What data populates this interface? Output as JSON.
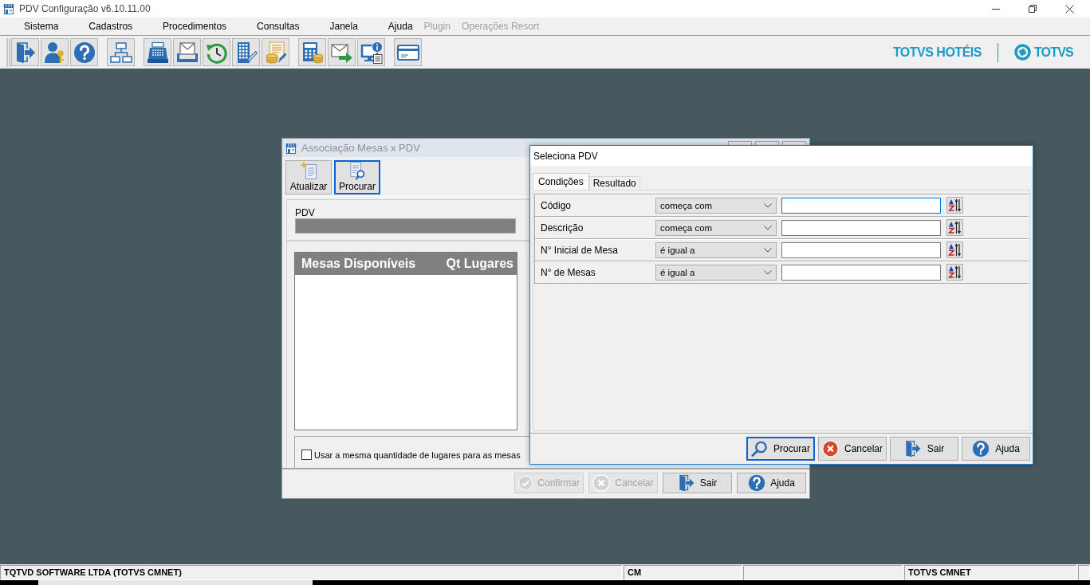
{
  "window": {
    "title": "PDV Configuração v6.10.11.00"
  },
  "menu": [
    {
      "label": "Sistema",
      "disabled": false
    },
    {
      "label": "Cadastros",
      "disabled": false
    },
    {
      "label": "Procedimentos",
      "disabled": false
    },
    {
      "label": "Consultas",
      "disabled": false
    },
    {
      "label": "Janela",
      "disabled": false
    },
    {
      "label": "Ajuda",
      "disabled": false
    },
    {
      "label": "Plugin",
      "disabled": true
    },
    {
      "label": "Operações Resort",
      "disabled": true
    }
  ],
  "brand": {
    "product": "TOTVS HOTÉIS",
    "company": "TOTVS"
  },
  "association_dialog": {
    "title": "Associação Mesas x PDV",
    "active": false,
    "toolbar": [
      {
        "label": "Atualizar",
        "kind": "refresh",
        "focused": false
      },
      {
        "label": "Procurar",
        "kind": "search",
        "focused": true
      }
    ],
    "pdv_field": {
      "label": "PDV",
      "disabled": true
    },
    "table": {
      "columns": [
        "Mesas Disponíveis",
        "Qt Lugares"
      ]
    },
    "same_seats": {
      "label": "Usar a mesma quantidade de lugares para as mesas",
      "checked": false
    },
    "buttons": [
      {
        "label": "Confirmar",
        "kind": "confirm",
        "disabled": true
      },
      {
        "label": "Cancelar",
        "kind": "cancel",
        "disabled": true
      },
      {
        "label": "Sair",
        "kind": "exit",
        "disabled": false
      },
      {
        "label": "Ajuda",
        "kind": "help",
        "disabled": false
      }
    ]
  },
  "select_dialog": {
    "title": "Seleciona PDV",
    "active": true,
    "tabs": [
      {
        "label": "Condições",
        "selected": true
      },
      {
        "label": "Resultado",
        "selected": false
      }
    ],
    "conditions": [
      {
        "field": "Código",
        "operator": "começa com",
        "focused": true
      },
      {
        "field": "Descrição",
        "operator": "começa com",
        "focused": false
      },
      {
        "field": "N° Inicial de Mesa",
        "operator": "é igual a",
        "focused": false
      },
      {
        "field": "N° de Mesas",
        "operator": "é igual a",
        "focused": false
      }
    ],
    "buttons": [
      {
        "label": "Procurar",
        "kind": "search",
        "focused": true
      },
      {
        "label": "Cancelar",
        "kind": "cancel",
        "focused": false
      },
      {
        "label": "Sair",
        "kind": "exit",
        "focused": false
      },
      {
        "label": "Ajuda",
        "kind": "help",
        "focused": false
      }
    ]
  },
  "status_bar": {
    "company": "TQTVD SOFTWARE LTDA (TOTVS CMNET)",
    "code": "CM",
    "system": "TOTVS CMNET"
  }
}
